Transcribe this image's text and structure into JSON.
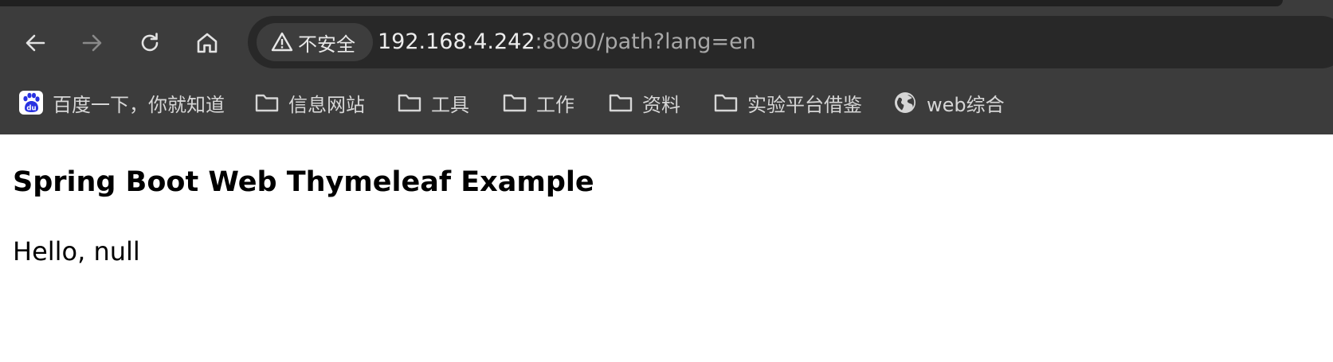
{
  "browser": {
    "address_bar": {
      "security_label": "不安全",
      "url_host": "192.168.4.242",
      "url_rest": ":8090/path?lang=en"
    },
    "bookmarks": [
      {
        "label": "百度一下，你就知道",
        "icon": "baidu-icon"
      },
      {
        "label": "信息网站",
        "icon": "folder-icon"
      },
      {
        "label": "工具",
        "icon": "folder-icon"
      },
      {
        "label": "工作",
        "icon": "folder-icon"
      },
      {
        "label": "资料",
        "icon": "folder-icon"
      },
      {
        "label": "实验平台借鉴",
        "icon": "folder-icon"
      },
      {
        "label": "web综合",
        "icon": "globe-icon"
      }
    ],
    "colors": {
      "chrome_bg": "#3c3c3c",
      "omnibox_bg": "#282828",
      "icon_active": "#e3e3e3",
      "icon_disabled": "#8a8a8a",
      "baidu_blue": "#2932e1"
    }
  },
  "page": {
    "title": "Spring Boot Web Thymeleaf Example",
    "greeting": "Hello, null"
  }
}
